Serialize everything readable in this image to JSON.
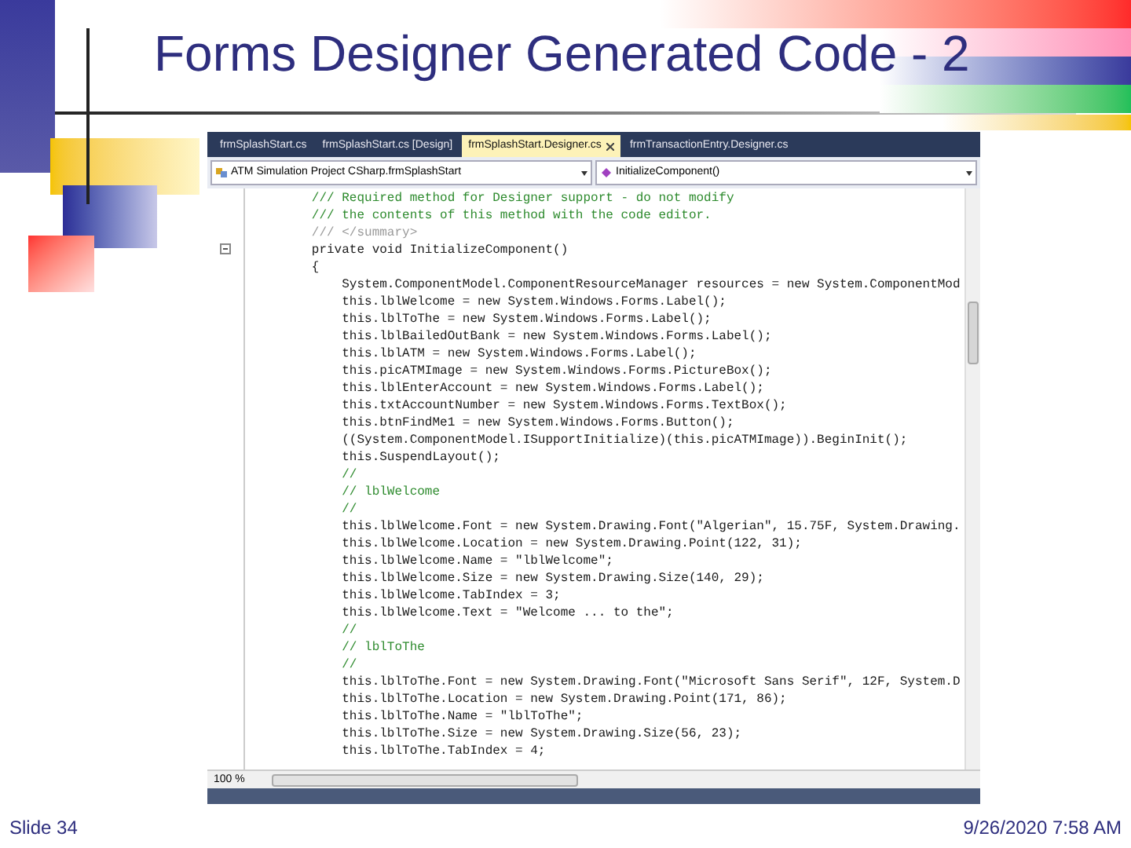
{
  "slide": {
    "title": "Forms Designer Generated Code - 2",
    "number": "Slide 34",
    "date": "9/26/2020 7:58 AM"
  },
  "editor": {
    "tabs": [
      {
        "label": "frmSplashStart.cs",
        "selected": false
      },
      {
        "label": "frmSplashStart.cs [Design]",
        "selected": false
      },
      {
        "label": "frmSplashStart.Designer.cs",
        "selected": true
      },
      {
        "label": "frmTransactionEntry.Designer.cs",
        "selected": false
      }
    ],
    "class_dropdown": "ATM Simulation Project CSharp.frmSplashStart",
    "member_dropdown": "InitializeComponent()",
    "lines": [
      {
        "kind": "comment",
        "text": "        /// Required method for Designer support - do not modify"
      },
      {
        "kind": "comment",
        "text": "        /// the contents of this method with the code editor."
      },
      {
        "kind": "doc",
        "text": "        /// </summary>"
      },
      {
        "kind": "code",
        "text": "        private void InitializeComponent()",
        "collapsible": true
      },
      {
        "kind": "code",
        "text": "        {"
      },
      {
        "kind": "code",
        "text": "            System.ComponentModel.ComponentResourceManager resources = new System.ComponentMod"
      },
      {
        "kind": "code",
        "text": "            this.lblWelcome = new System.Windows.Forms.Label();"
      },
      {
        "kind": "code",
        "text": "            this.lblToThe = new System.Windows.Forms.Label();"
      },
      {
        "kind": "code",
        "text": "            this.lblBailedOutBank = new System.Windows.Forms.Label();"
      },
      {
        "kind": "code",
        "text": "            this.lblATM = new System.Windows.Forms.Label();"
      },
      {
        "kind": "code",
        "text": "            this.picATMImage = new System.Windows.Forms.PictureBox();"
      },
      {
        "kind": "code",
        "text": "            this.lblEnterAccount = new System.Windows.Forms.Label();"
      },
      {
        "kind": "code",
        "text": "            this.txtAccountNumber = new System.Windows.Forms.TextBox();"
      },
      {
        "kind": "code",
        "text": "            this.btnFindMe1 = new System.Windows.Forms.Button();"
      },
      {
        "kind": "code",
        "text": "            ((System.ComponentModel.ISupportInitialize)(this.picATMImage)).BeginInit();"
      },
      {
        "kind": "code",
        "text": "            this.SuspendLayout();"
      },
      {
        "kind": "comment",
        "text": "            //"
      },
      {
        "kind": "comment",
        "text": "            // lblWelcome"
      },
      {
        "kind": "comment",
        "text": "            //"
      },
      {
        "kind": "code",
        "text": "            this.lblWelcome.Font = new System.Drawing.Font(\"Algerian\", 15.75F, System.Drawing."
      },
      {
        "kind": "code",
        "text": "            this.lblWelcome.Location = new System.Drawing.Point(122, 31);"
      },
      {
        "kind": "code",
        "text": "            this.lblWelcome.Name = \"lblWelcome\";"
      },
      {
        "kind": "code",
        "text": "            this.lblWelcome.Size = new System.Drawing.Size(140, 29);"
      },
      {
        "kind": "code",
        "text": "            this.lblWelcome.TabIndex = 3;"
      },
      {
        "kind": "code",
        "text": "            this.lblWelcome.Text = \"Welcome ... to the\";"
      },
      {
        "kind": "comment",
        "text": "            //"
      },
      {
        "kind": "comment",
        "text": "            // lblToThe"
      },
      {
        "kind": "comment",
        "text": "            //"
      },
      {
        "kind": "code",
        "text": "            this.lblToThe.Font = new System.Drawing.Font(\"Microsoft Sans Serif\", 12F, System.D"
      },
      {
        "kind": "code",
        "text": "            this.lblToThe.Location = new System.Drawing.Point(171, 86);"
      },
      {
        "kind": "code",
        "text": "            this.lblToThe.Name = \"lblToThe\";"
      },
      {
        "kind": "code",
        "text": "            this.lblToThe.Size = new System.Drawing.Size(56, 23);"
      },
      {
        "kind": "code",
        "text": "            this.lblToThe.TabIndex = 4;"
      }
    ],
    "zoom": "100 %"
  }
}
